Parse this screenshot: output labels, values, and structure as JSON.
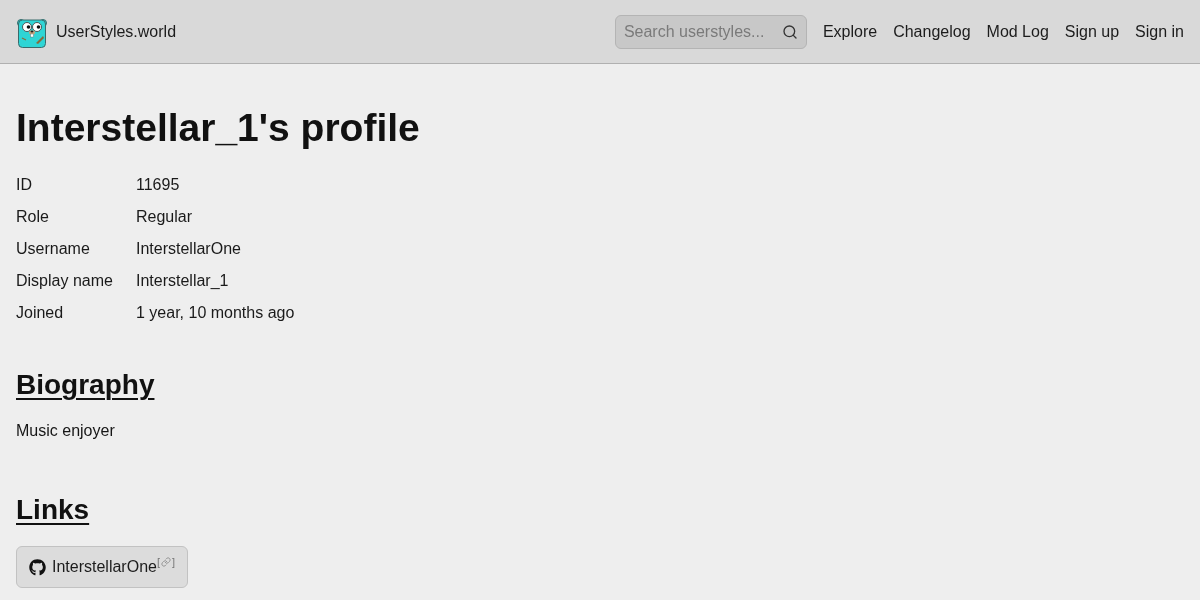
{
  "header": {
    "site_name": "UserStyles.world",
    "search": {
      "placeholder": "Search userstyles..."
    },
    "nav": [
      "Explore",
      "Changelog",
      "Mod Log",
      "Sign up",
      "Sign in"
    ]
  },
  "profile": {
    "title": "Interstellar_1's profile",
    "details": [
      {
        "label": "ID",
        "value": "11695"
      },
      {
        "label": "Role",
        "value": "Regular"
      },
      {
        "label": "Username",
        "value": "InterstellarOne"
      },
      {
        "label": "Display name",
        "value": "Interstellar_1"
      },
      {
        "label": "Joined",
        "value": "1 year, 10 months ago"
      }
    ]
  },
  "biography": {
    "heading": "Biography",
    "text": "Music enjoyer"
  },
  "links": {
    "heading": "Links",
    "items": [
      {
        "kind": "github",
        "label": "InterstellarOne",
        "marker_open": "[",
        "marker_close": "]"
      }
    ]
  }
}
